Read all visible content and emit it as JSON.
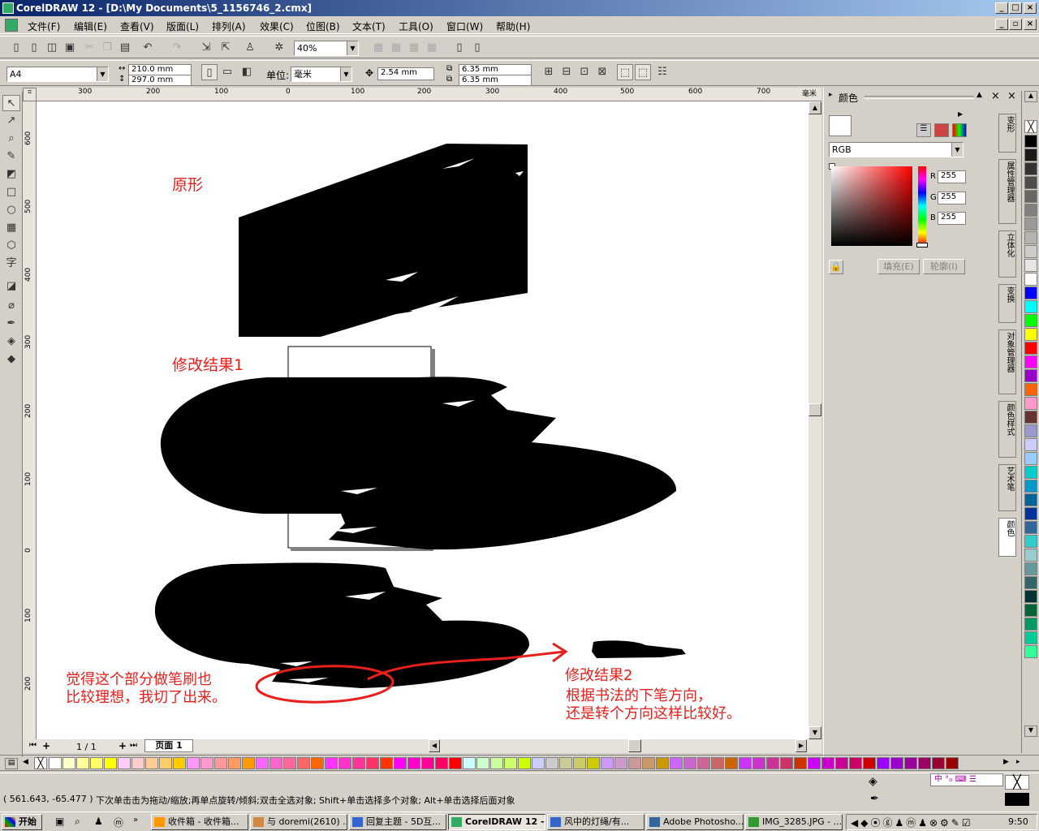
{
  "window": {
    "title": "CorelDRAW 12 - [D:\\My Documents\\5_1156746_2.cmx]"
  },
  "menu": [
    "文件(F)",
    "编辑(E)",
    "查看(V)",
    "版面(L)",
    "排列(A)",
    "效果(C)",
    "位图(B)",
    "文本(T)",
    "工具(O)",
    "窗口(W)",
    "帮助(H)"
  ],
  "toolbar": {
    "zoom": "40%"
  },
  "propbar": {
    "paper": "A4",
    "width": "210.0 mm",
    "height": "297.0 mm",
    "units_label": "单位:",
    "units": "毫米",
    "nudge": "2.54 mm",
    "dup_x": "6.35 mm",
    "dup_y": "6.35 mm"
  },
  "ruler": {
    "top": [
      "300",
      "200",
      "100",
      "0",
      "100",
      "200",
      "300",
      "400",
      "500",
      "600",
      "700"
    ],
    "top_unit": "毫米",
    "left": [
      "600",
      "500",
      "400",
      "300",
      "200",
      "100",
      "0",
      "100",
      "200"
    ]
  },
  "canvas": {
    "label_original": "原形",
    "label_result1": "修改结果1",
    "note_brush": "觉得这个部分做笔刷也\n比较理想，我切了出来。",
    "label_result2": "修改结果2",
    "note_direction": "根据书法的下笔方向，\n还是转个方向这样比较好。"
  },
  "page_nav": {
    "count": "1 / 1",
    "tab": "页面 1"
  },
  "docker": {
    "title": "颜色",
    "model": "RGB",
    "r_label": "R",
    "g_label": "G",
    "b_label": "B",
    "r": "255",
    "g": "255",
    "b": "255",
    "fill_btn": "填充(E)",
    "outline_btn": "轮廓(I)"
  },
  "docker_tabs": [
    "变形",
    "属性管理器",
    "立体化",
    "变换",
    "对象管理器",
    "颜色样式",
    "艺术笔",
    "颜色"
  ],
  "status": {
    "coords": "( 561.643, -65.477 )",
    "hint": "下次单击击为拖动/缩放;再单点旋转/倾斜;双击全选对象; Shift+单击选择多个对象; Alt+单击选择后面对象"
  },
  "taskbar": {
    "start": "开始",
    "tasks": [
      "收件箱 - 收件箱...",
      "与 doremi(2610) ...",
      "回复主题 - 5D互...",
      "CorelDRAW 12 - ...",
      "风中的灯绳/有...",
      "Adobe Photosho...",
      "IMG_3285.JPG - ..."
    ],
    "clock": "9:50"
  },
  "palette_colors": [
    "#000000",
    "#1a1a1a",
    "#333333",
    "#4d4d4d",
    "#666666",
    "#808080",
    "#999999",
    "#b3b3b3",
    "#cccccc",
    "#e6e6e6",
    "#ffffff",
    "#0000ff",
    "#00ffff",
    "#00ff00",
    "#ffff00",
    "#ff0000",
    "#ff00ff",
    "#9900cc",
    "#ff6600",
    "#ff99cc",
    "#663333",
    "#9999cc",
    "#ccccff",
    "#99ccff",
    "#00cccc",
    "#0099cc",
    "#006699",
    "#003399",
    "#336699",
    "#33cccc",
    "#99cccc",
    "#669999",
    "#336666",
    "#003333",
    "#006633",
    "#009966",
    "#00cc99",
    "#33ff99"
  ],
  "hpalette_colors": [
    "#ffffff",
    "#ffffcc",
    "#ffff99",
    "#ffff66",
    "#ffff00",
    "#ffccff",
    "#ffcccc",
    "#ffcc99",
    "#ffcc66",
    "#ffcc00",
    "#ff99ff",
    "#ff99cc",
    "#ff9999",
    "#ff9966",
    "#ff9900",
    "#ff66ff",
    "#ff66cc",
    "#ff6699",
    "#ff6666",
    "#ff6600",
    "#ff33ff",
    "#ff33cc",
    "#ff3399",
    "#ff3366",
    "#ff3300",
    "#ff00ff",
    "#ff00cc",
    "#ff0099",
    "#ff0066",
    "#ff0000",
    "#ccffff",
    "#ccffcc",
    "#ccff99",
    "#ccff66",
    "#ccff00",
    "#ccccff",
    "#cccccc",
    "#cccc99",
    "#cccc66",
    "#cccc00",
    "#cc99ff",
    "#cc99cc",
    "#cc9999",
    "#cc9966",
    "#cc9900",
    "#cc66ff",
    "#cc66cc",
    "#cc6699",
    "#cc6666",
    "#cc6600",
    "#cc33ff",
    "#cc33cc",
    "#cc3399",
    "#cc3366",
    "#cc3300",
    "#cc00ff",
    "#cc00cc",
    "#cc0099",
    "#cc0066",
    "#cc0000",
    "#9900ff",
    "#9900cc",
    "#990099",
    "#990066",
    "#990033",
    "#990000"
  ]
}
